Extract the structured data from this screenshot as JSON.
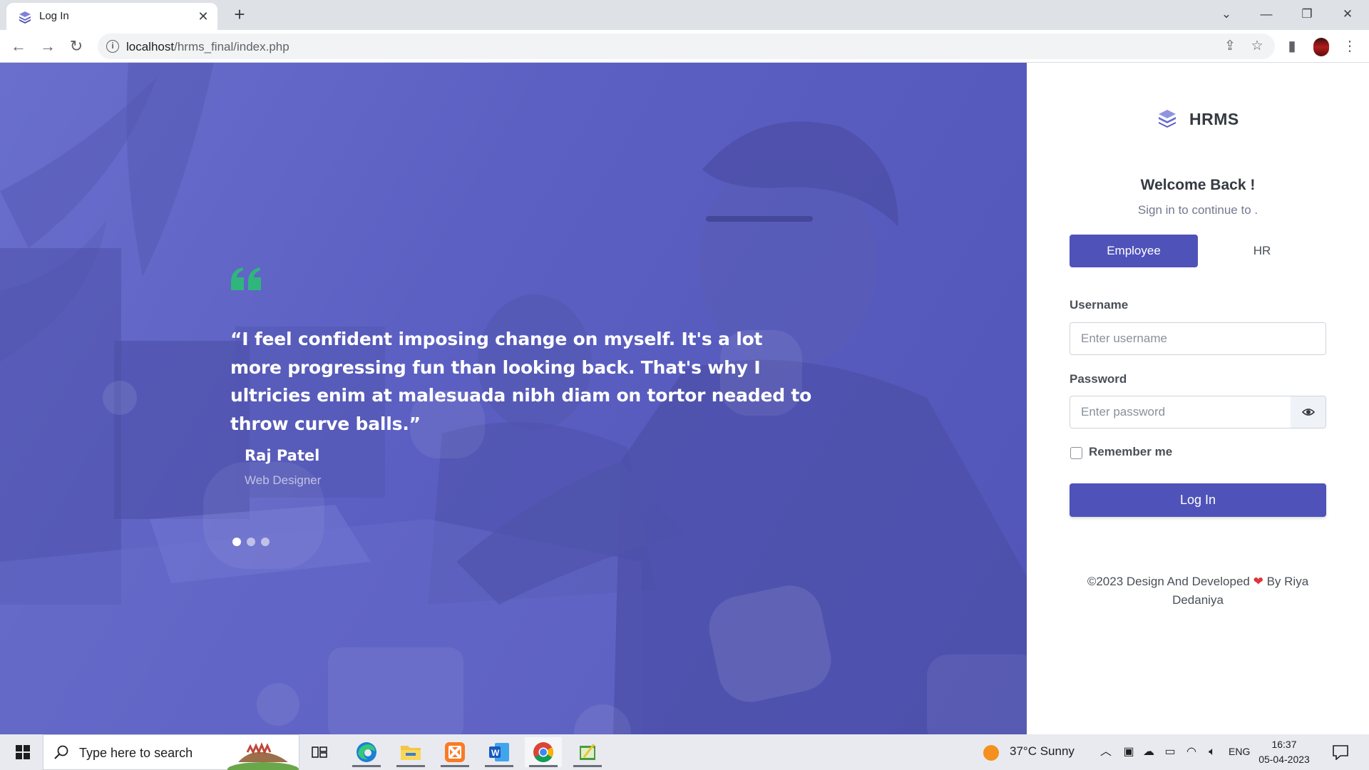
{
  "browser": {
    "tab_title": "Log In",
    "url_host": "localhost",
    "url_path": "/hrms_final/index.php"
  },
  "hero": {
    "quote": "“I feel confident imposing change on myself. It's a lot more progressing fun than looking back. That's why I ultricies enim at malesuada nibh diam on tortor neaded to throw curve balls.”",
    "author_name": "Raj Patel",
    "author_role": "Web Designer",
    "slides_total": 3,
    "active_slide": 1,
    "accent_color": "#2fb67c",
    "overlay_color": "#5c60c2"
  },
  "login": {
    "brand": "HRMS",
    "welcome": "Welcome Back !",
    "subtitle": "Sign in to continue to .",
    "tabs": [
      "Employee",
      "HR"
    ],
    "active_tab": "Employee",
    "username_label": "Username",
    "username_placeholder": "Enter username",
    "password_label": "Password",
    "password_placeholder": "Enter password",
    "remember_label": "Remember me",
    "submit_label": "Log In",
    "primary_color": "#4f52b9",
    "footer_prefix": "©2023 Design And Developed",
    "footer_suffix": "By Riya Dedaniya"
  },
  "taskbar": {
    "search_placeholder": "Type here to search",
    "weather": "37°C  Sunny",
    "language": "ENG",
    "time": "16:37",
    "date": "05-04-2023",
    "apps": [
      "task-view",
      "edge",
      "file-explorer",
      "xampp",
      "word",
      "chrome",
      "notepad-editor"
    ]
  }
}
